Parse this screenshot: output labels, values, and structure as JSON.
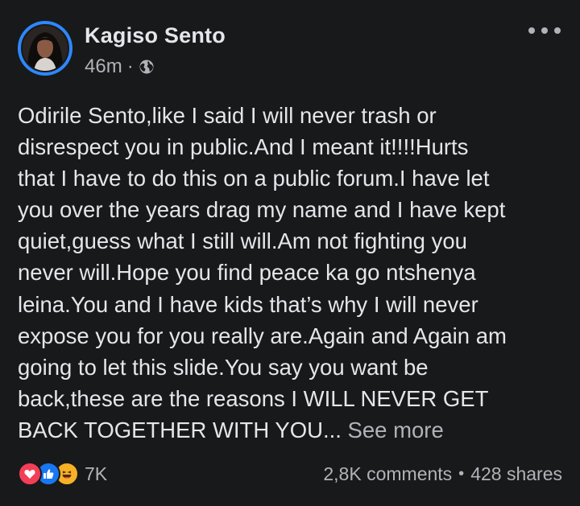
{
  "post": {
    "author": "Kagiso Sento",
    "timestamp": "46m",
    "separator": "·",
    "privacy_icon": "globe-icon",
    "menu_icon": "more-options-icon",
    "body_lines": [
      "Odirile Sento,like I said I will never trash or",
      "disrespect you in public.And I meant it!!!!Hurts",
      "that I have to do this on a public forum.I have let",
      "you over the years drag my name and I have kept",
      "quiet,guess what I still will.Am not fighting you",
      "never will.Hope you find peace ka go ntshenya",
      "leina.You and I have kids that’s why I will never",
      "expose you for you really are.Again and Again am",
      "going to let this slide.You say you want be",
      "back,these are the reasons I WILL NEVER GET",
      "BACK TOGETHER WITH YOU..."
    ],
    "see_more": "See more"
  },
  "footer": {
    "reactions": [
      "love-icon",
      "like-icon",
      "haha-icon"
    ],
    "reaction_count": "7K",
    "comments": "2,8K comments",
    "bullet": "•",
    "shares": "428 shares"
  },
  "colors": {
    "background": "#18191a",
    "text": "#e4e6eb",
    "secondary": "#b0b3b8",
    "avatar_ring": "#2d88ff",
    "love": "#f33e58",
    "like": "#1877f2",
    "haha": "#f7b125"
  }
}
